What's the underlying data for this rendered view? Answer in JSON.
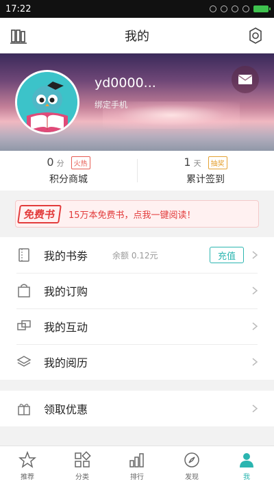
{
  "status_bar": {
    "time": "17:22"
  },
  "header": {
    "title": "我的"
  },
  "profile": {
    "username": "yd0000...",
    "bind_phone": "绑定手机"
  },
  "stats": [
    {
      "number": "0",
      "unit": "分",
      "badge": "火热",
      "label": "积分商城"
    },
    {
      "number": "1",
      "unit": "天",
      "badge": "抽奖",
      "label": "累计签到"
    }
  ],
  "promo": {
    "logo": "免费书",
    "text": "15万本免费书，点我一键阅读！"
  },
  "menu": {
    "vouchers": {
      "label": "我的书劵",
      "balance": "余额 0.12元",
      "recharge": "充值"
    },
    "orders": {
      "label": "我的订购"
    },
    "interactions": {
      "label": "我的互动"
    },
    "reading_history": {
      "label": "我的阅历"
    },
    "coupons": {
      "label": "领取优惠"
    }
  },
  "tabs": [
    {
      "label": "推荐",
      "icon": "star-icon"
    },
    {
      "label": "分类",
      "icon": "category-icon"
    },
    {
      "label": "排行",
      "icon": "chart-icon"
    },
    {
      "label": "发现",
      "icon": "compass-icon"
    },
    {
      "label": "我",
      "icon": "person-icon",
      "active": true
    }
  ],
  "colors": {
    "accent": "#2bb5b0",
    "promo_red": "#e23b3b",
    "badge_red": "#e65b52",
    "badge_orange": "#e4a132"
  }
}
